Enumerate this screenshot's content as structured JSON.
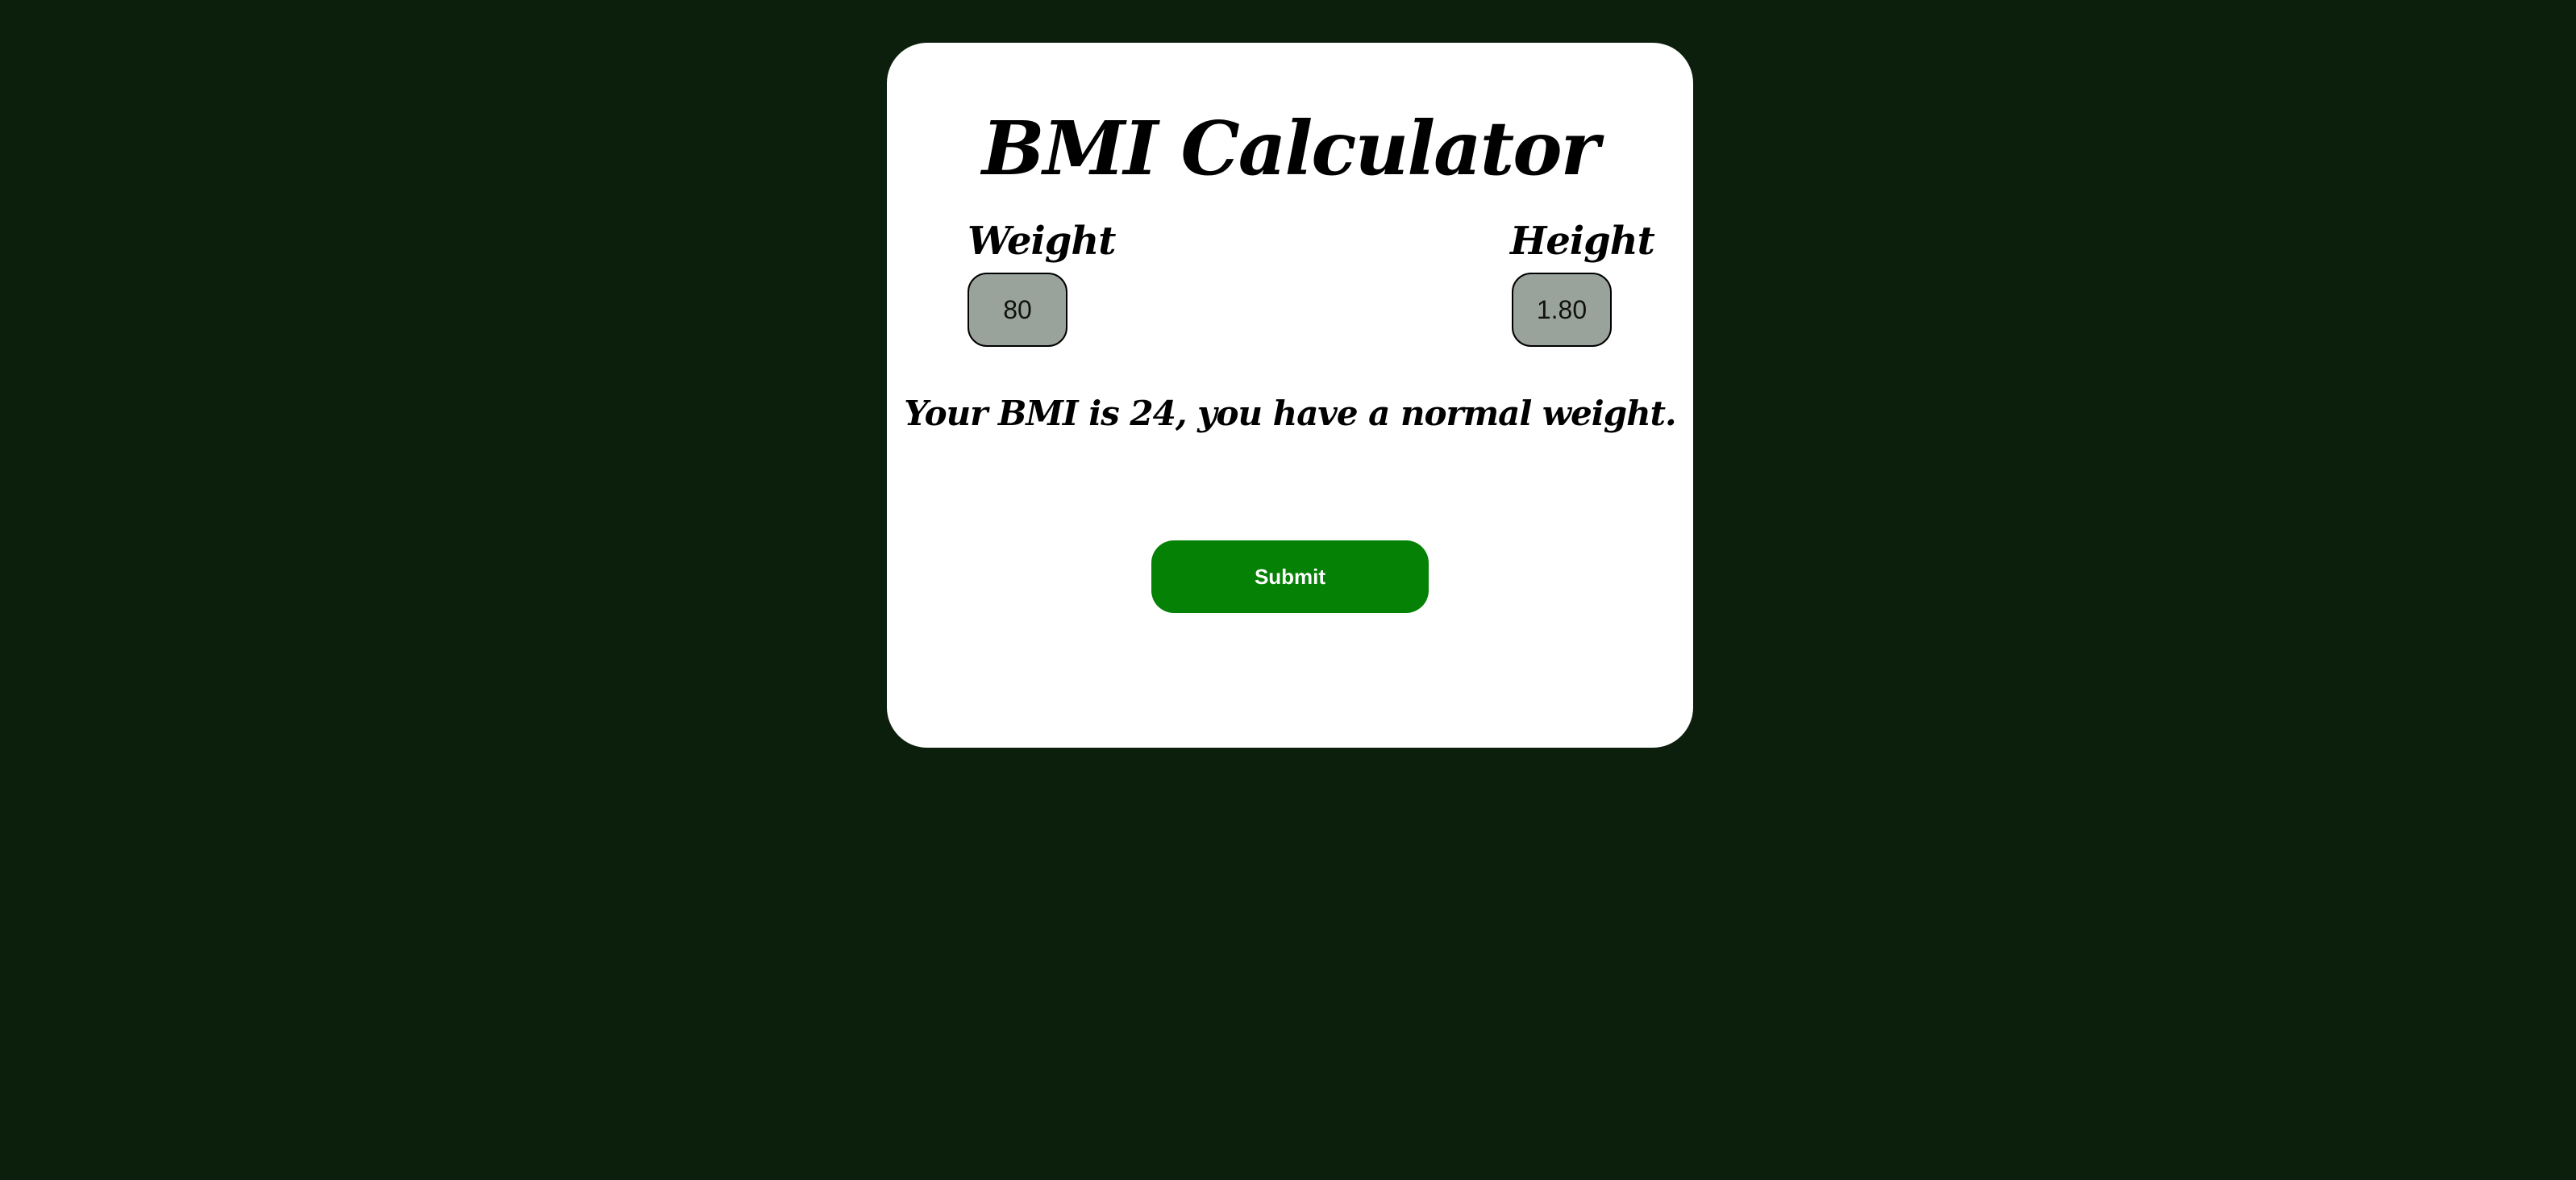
{
  "app": {
    "title": "BMI Calculator"
  },
  "form": {
    "weight_label": "Weight",
    "weight_value": "80",
    "height_label": "Height",
    "height_value": "1.80",
    "result_text": "Your BMI is 24, you have a normal weight.",
    "submit_label": "Submit"
  },
  "colors": {
    "background": "#0b1f0c",
    "card": "#ffffff",
    "input_fill": "#9aa39b",
    "submit_button": "#058105"
  }
}
